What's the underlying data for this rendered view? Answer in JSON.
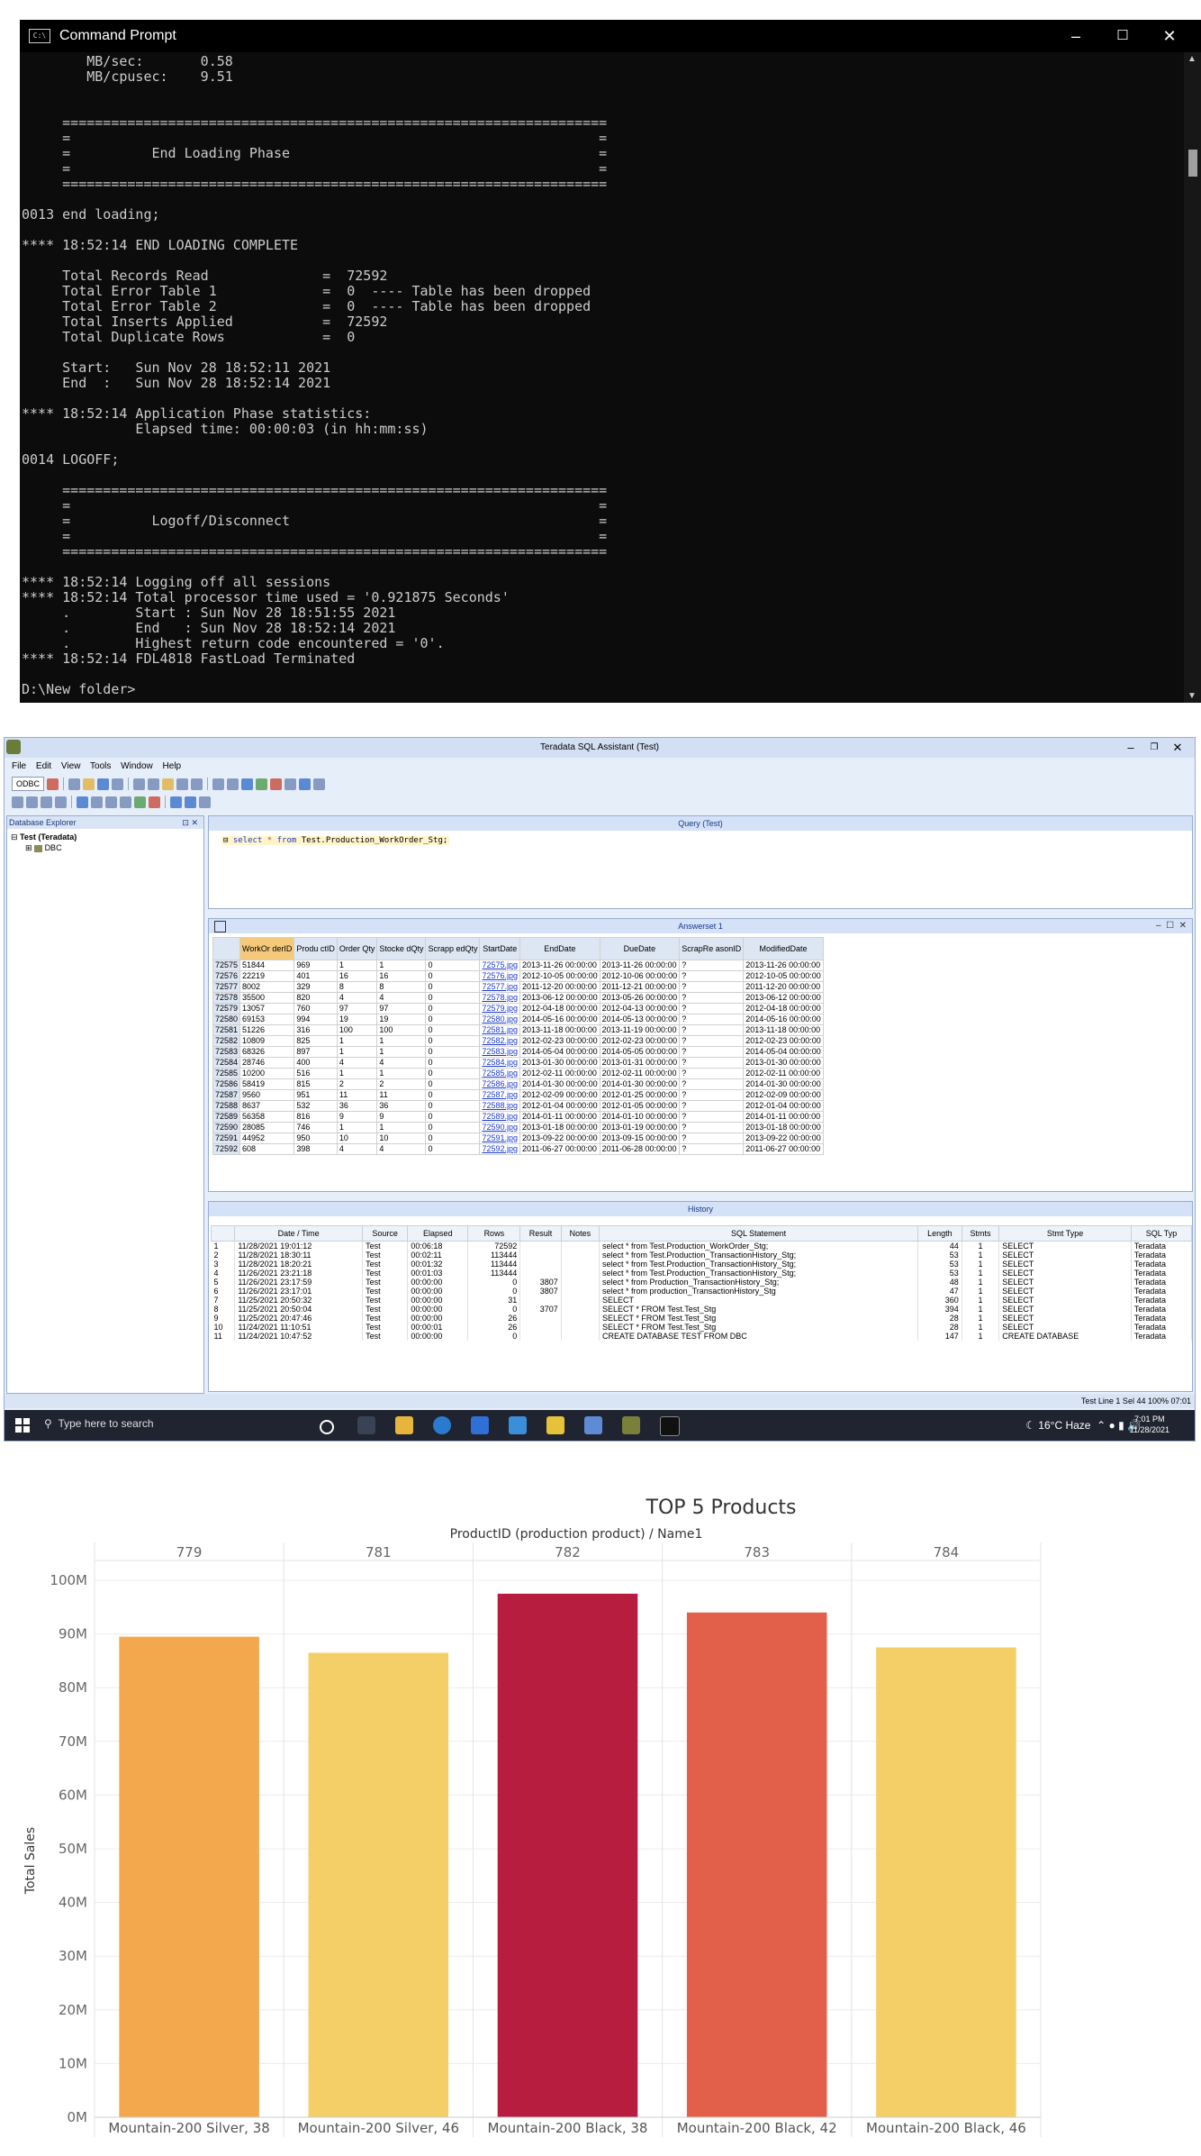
{
  "cmd": {
    "title": "Command Prompt",
    "lines": [
      "        MB/sec:       0.58",
      "        MB/cpusec:    9.51",
      "",
      "",
      "     ===================================================================",
      "     =                                                                 =",
      "     =          End Loading Phase                                      =",
      "     =                                                                 =",
      "     ===================================================================",
      "",
      "0013 end loading;",
      "",
      "**** 18:52:14 END LOADING COMPLETE",
      "",
      "     Total Records Read              =  72592",
      "     Total Error Table 1             =  0  ---- Table has been dropped",
      "     Total Error Table 2             =  0  ---- Table has been dropped",
      "     Total Inserts Applied           =  72592",
      "     Total Duplicate Rows            =  0",
      "",
      "     Start:   Sun Nov 28 18:52:11 2021",
      "     End  :   Sun Nov 28 18:52:14 2021",
      "",
      "**** 18:52:14 Application Phase statistics:",
      "              Elapsed time: 00:00:03 (in hh:mm:ss)",
      "",
      "0014 LOGOFF;",
      "",
      "     ===================================================================",
      "     =                                                                 =",
      "     =          Logoff/Disconnect                                      =",
      "     =                                                                 =",
      "     ===================================================================",
      "",
      "**** 18:52:14 Logging off all sessions",
      "**** 18:52:14 Total processor time used = '0.921875 Seconds'",
      "     .        Start : Sun Nov 28 18:51:55 2021",
      "     .        End   : Sun Nov 28 18:52:14 2021",
      "     .        Highest return code encountered = '0'.",
      "**** 18:52:14 FDL4818 FastLoad Terminated",
      "",
      "D:\\New folder>"
    ]
  },
  "sqla": {
    "title": "Teradata SQL Assistant (Test)",
    "menu": [
      "File",
      "Edit",
      "View",
      "Tools",
      "Window",
      "Help"
    ],
    "datasource": "ODBC",
    "db_explorer": {
      "label": "Database Explorer",
      "root": "Test (Teradata)",
      "child": "DBC"
    },
    "query": {
      "pane_title": "Query (Test)",
      "kw_select": "select",
      "op_star": "*",
      "kw_from": "from",
      "table": "Test.Production_WorkOrder_Stg;"
    },
    "answerset": {
      "pane_title": "Answerset 1",
      "columns": [
        "WorkOr derID",
        "Produ ctID",
        "Order Qty",
        "Stocke dQty",
        "Scrapp edQty",
        "StartDate",
        "EndDate",
        "DueDate",
        "ScrapRe asonID",
        "ModifiedDate"
      ],
      "rows": [
        [
          "72575",
          "51844",
          "969",
          "1",
          "1",
          "0",
          "72575.jpg",
          "2013-11-26 00:00:00",
          "2013-11-26 00:00:00",
          "?",
          "2013-11-26 00:00:00"
        ],
        [
          "72576",
          "22219",
          "401",
          "16",
          "16",
          "0",
          "72576.jpg",
          "2012-10-05 00:00:00",
          "2012-10-06 00:00:00",
          "?",
          "2012-10-05 00:00:00"
        ],
        [
          "72577",
          "8002",
          "329",
          "8",
          "8",
          "0",
          "72577.jpg",
          "2011-12-20 00:00:00",
          "2011-12-21 00:00:00",
          "?",
          "2011-12-20 00:00:00"
        ],
        [
          "72578",
          "35500",
          "820",
          "4",
          "4",
          "0",
          "72578.jpg",
          "2013-06-12 00:00:00",
          "2013-05-26 00:00:00",
          "?",
          "2013-06-12 00:00:00"
        ],
        [
          "72579",
          "13057",
          "760",
          "97",
          "97",
          "0",
          "72579.jpg",
          "2012-04-18 00:00:00",
          "2012-04-13 00:00:00",
          "?",
          "2012-04-18 00:00:00"
        ],
        [
          "72580",
          "69153",
          "994",
          "19",
          "19",
          "0",
          "72580.jpg",
          "2014-05-16 00:00:00",
          "2014-05-13 00:00:00",
          "?",
          "2014-05-16 00:00:00"
        ],
        [
          "72581",
          "51226",
          "316",
          "100",
          "100",
          "0",
          "72581.jpg",
          "2013-11-18 00:00:00",
          "2013-11-19 00:00:00",
          "?",
          "2013-11-18 00:00:00"
        ],
        [
          "72582",
          "10809",
          "825",
          "1",
          "1",
          "0",
          "72582.jpg",
          "2012-02-23 00:00:00",
          "2012-02-23 00:00:00",
          "?",
          "2012-02-23 00:00:00"
        ],
        [
          "72583",
          "68326",
          "897",
          "1",
          "1",
          "0",
          "72583.jpg",
          "2014-05-04 00:00:00",
          "2014-05-05 00:00:00",
          "?",
          "2014-05-04 00:00:00"
        ],
        [
          "72584",
          "28746",
          "400",
          "4",
          "4",
          "0",
          "72584.jpg",
          "2013-01-30 00:00:00",
          "2013-01-31 00:00:00",
          "?",
          "2013-01-30 00:00:00"
        ],
        [
          "72585",
          "10200",
          "516",
          "1",
          "1",
          "0",
          "72585.jpg",
          "2012-02-11 00:00:00",
          "2012-02-11 00:00:00",
          "?",
          "2012-02-11 00:00:00"
        ],
        [
          "72586",
          "58419",
          "815",
          "2",
          "2",
          "0",
          "72586.jpg",
          "2014-01-30 00:00:00",
          "2014-01-30 00:00:00",
          "?",
          "2014-01-30 00:00:00"
        ],
        [
          "72587",
          "9560",
          "951",
          "11",
          "11",
          "0",
          "72587.jpg",
          "2012-02-09 00:00:00",
          "2012-01-25 00:00:00",
          "?",
          "2012-02-09 00:00:00"
        ],
        [
          "72588",
          "8637",
          "532",
          "36",
          "36",
          "0",
          "72588.jpg",
          "2012-01-04 00:00:00",
          "2012-01-05 00:00:00",
          "?",
          "2012-01-04 00:00:00"
        ],
        [
          "72589",
          "56358",
          "816",
          "9",
          "9",
          "0",
          "72589.jpg",
          "2014-01-11 00:00:00",
          "2014-01-10 00:00:00",
          "?",
          "2014-01-11 00:00:00"
        ],
        [
          "72590",
          "28085",
          "746",
          "1",
          "1",
          "0",
          "72590.jpg",
          "2013-01-18 00:00:00",
          "2013-01-19 00:00:00",
          "?",
          "2013-01-18 00:00:00"
        ],
        [
          "72591",
          "44952",
          "950",
          "10",
          "10",
          "0",
          "72591.jpg",
          "2013-09-22 00:00:00",
          "2013-09-15 00:00:00",
          "?",
          "2013-09-22 00:00:00"
        ],
        [
          "72592",
          "608",
          "398",
          "4",
          "4",
          "0",
          "72592.jpg",
          "2011-06-27 00:00:00",
          "2011-06-28 00:00:00",
          "?",
          "2011-06-27 00:00:00"
        ]
      ]
    },
    "history": {
      "pane_title": "History",
      "columns": [
        "",
        "Date / Time",
        "Source",
        "Elapsed",
        "Rows",
        "Result",
        "Notes",
        "SQL Statement",
        "Length",
        "Stmts",
        "Stmt Type",
        "SQL Typ"
      ],
      "rows": [
        [
          "1",
          "11/28/2021 19:01:12",
          "Test",
          "00:06:18",
          "72592",
          "",
          "",
          "select * from Test.Production_WorkOrder_Stg;",
          "44",
          "1",
          "SELECT",
          "Teradata"
        ],
        [
          "2",
          "11/28/2021 18:30:11",
          "Test",
          "00:02:11",
          "113444",
          "",
          "",
          "select * from Test.Production_TransactionHistory_Stg;",
          "53",
          "1",
          "SELECT",
          "Teradata"
        ],
        [
          "3",
          "11/28/2021 18:20:21",
          "Test",
          "00:01:32",
          "113444",
          "",
          "",
          "select * from Test.Production_TransactionHistory_Stg;",
          "53",
          "1",
          "SELECT",
          "Teradata"
        ],
        [
          "4",
          "11/26/2021 23:21:18",
          "Test",
          "00:01:03",
          "113444",
          "",
          "",
          "select * from Test.Production_TransactionHistory_Stg;",
          "53",
          "1",
          "SELECT",
          "Teradata"
        ],
        [
          "5",
          "11/26/2021 23:17:59",
          "Test",
          "00:00:00",
          "0",
          "3807",
          "",
          "select * from Production_TransactionHistory_Stg;",
          "48",
          "1",
          "SELECT",
          "Teradata"
        ],
        [
          "6",
          "11/26/2021 23:17:01",
          "Test",
          "00:00:00",
          "0",
          "3807",
          "",
          "select * from production_TransactionHistory_Stg",
          "47",
          "1",
          "SELECT",
          "Teradata"
        ],
        [
          "7",
          "11/25/2021 20:50:32",
          "Test",
          "00:00:00",
          "31",
          "",
          "",
          "SELECT",
          "360",
          "1",
          "SELECT",
          "Teradata"
        ],
        [
          "8",
          "11/25/2021 20:50:04",
          "Test",
          "00:00:00",
          "0",
          "3707",
          "",
          "SELECT * FROM  Test.Test_Stg",
          "394",
          "1",
          "SELECT",
          "Teradata"
        ],
        [
          "9",
          "11/25/2021 20:47:46",
          "Test",
          "00:00:00",
          "26",
          "",
          "",
          "SELECT * FROM  Test.Test_Stg",
          "28",
          "1",
          "SELECT",
          "Teradata"
        ],
        [
          "10",
          "11/24/2021 11:10:51",
          "Test",
          "00:00:01",
          "26",
          "",
          "",
          "SELECT * FROM  Test.Test_Stg",
          "28",
          "1",
          "SELECT",
          "Teradata"
        ],
        [
          "11",
          "11/24/2021 10:47:52",
          "Test",
          "00:00:00",
          "0",
          "",
          "",
          "CREATE DATABASE TEST FROM DBC",
          "147",
          "1",
          "CREATE DATABASE",
          "Teradata"
        ]
      ]
    },
    "status": "Test   Line 1   Sel 44   100%   07:01",
    "taskbar": {
      "search_placeholder": "Type here to search",
      "weather": "16°C  Haze",
      "time": "7:01 PM",
      "date": "11/28/2021"
    }
  },
  "chart_data": {
    "type": "bar",
    "title": "TOP 5 Products",
    "header_label": "ProductID (production product)  /  Name1",
    "ylabel": "Total Sales",
    "ylim": [
      0,
      100
    ],
    "y_unit_suffix": "M",
    "yticks": [
      0,
      10,
      20,
      30,
      40,
      50,
      60,
      70,
      80,
      90,
      100
    ],
    "grid": true,
    "categories": [
      "779",
      "781",
      "782",
      "783",
      "784"
    ],
    "names": [
      "Mountain-200 Silver, 38",
      "Mountain-200 Silver, 46",
      "Mountain-200 Black, 38",
      "Mountain-200 Black, 42",
      "Mountain-200 Black, 46"
    ],
    "values": [
      89.5,
      86.5,
      97.5,
      94,
      87.5
    ],
    "colors": [
      "#f3a84e",
      "#f4cf68",
      "#b61d3f",
      "#e2604a",
      "#f4cf68"
    ]
  }
}
